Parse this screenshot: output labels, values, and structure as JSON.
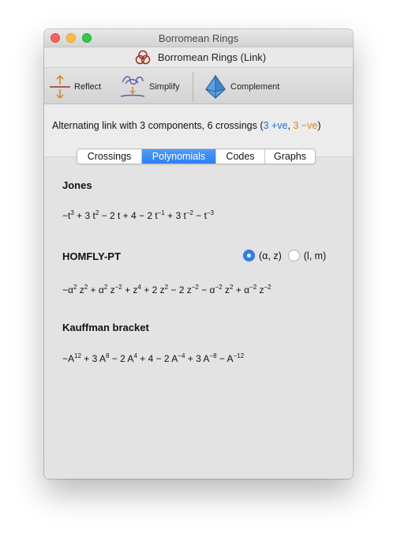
{
  "window": {
    "title": "Borromean Rings",
    "document_title": "Borromean Rings (Link)",
    "document_icon": "borromean-rings-icon"
  },
  "toolbar": {
    "reflect": {
      "label": "Reflect",
      "icon": "reflect-icon"
    },
    "simplify": {
      "label": "Simplify",
      "icon": "simplify-icon"
    },
    "complement": {
      "label": "Complement",
      "icon": "complement-icon"
    }
  },
  "summary": {
    "text": "Alternating link with 3 components, 6 crossings (",
    "positive": "3 +ve",
    "separator": ", ",
    "negative": "3 −ve",
    "close": ")"
  },
  "tabs": [
    {
      "label": "Crossings",
      "active": false
    },
    {
      "label": "Polynomials",
      "active": true
    },
    {
      "label": "Codes",
      "active": false
    },
    {
      "label": "Graphs",
      "active": false
    }
  ],
  "jones": {
    "title": "Jones",
    "terms": [
      [
        "−t",
        "3"
      ],
      [
        " + 3 t",
        "2"
      ],
      [
        " − 2 t + 4 − 2 t",
        "−1"
      ],
      [
        " + 3 t",
        "−2"
      ],
      [
        " − t",
        "−3"
      ]
    ]
  },
  "homfly": {
    "title": "HOMFLY-PT",
    "options": [
      {
        "label": "(α, z)",
        "selected": true
      },
      {
        "label": "(l, m)",
        "selected": false
      }
    ],
    "terms": [
      [
        "−α",
        "2"
      ],
      [
        " z",
        "2"
      ],
      [
        " + α",
        "2"
      ],
      [
        " z",
        "−2"
      ],
      [
        " + z",
        "4"
      ],
      [
        " + 2 z",
        "2"
      ],
      [
        " − 2 z",
        "−2"
      ],
      [
        " − α",
        "−2"
      ],
      [
        " z",
        "2"
      ],
      [
        " + α",
        "−2"
      ],
      [
        " z",
        "−2"
      ]
    ]
  },
  "kauffman": {
    "title": "Kauffman bracket",
    "terms": [
      [
        "−A",
        "12"
      ],
      [
        " + 3 A",
        "8"
      ],
      [
        " − 2 A",
        "4"
      ],
      [
        " + 4 − 2 A",
        "−4"
      ],
      [
        " + 3 A",
        "−8"
      ],
      [
        " − A",
        "−12"
      ]
    ]
  },
  "colors": {
    "accent": "#2f7ff0",
    "positive": "#1e6fd6",
    "negative": "#d7861b"
  }
}
